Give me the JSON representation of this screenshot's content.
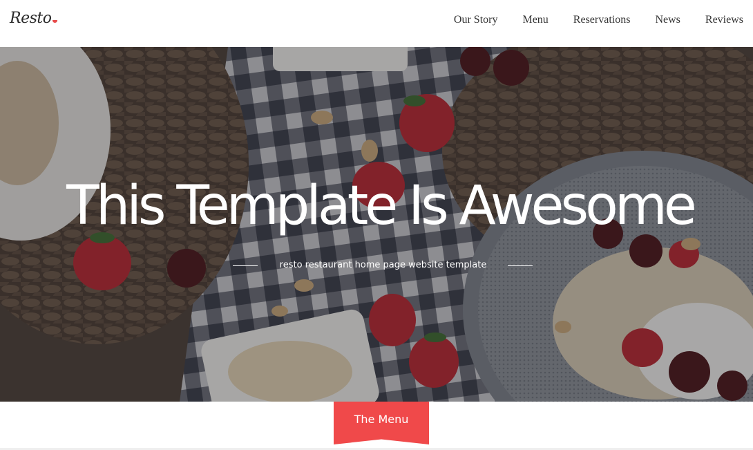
{
  "brand": {
    "logo_text": "Resto",
    "accent": "#f0494a"
  },
  "nav": {
    "items": [
      {
        "label": "Our Story"
      },
      {
        "label": "Menu"
      },
      {
        "label": "Reservations"
      },
      {
        "label": "News"
      },
      {
        "label": "Reviews"
      }
    ]
  },
  "hero": {
    "title": "This Template Is Awesome",
    "subtitle": "resto restaurant home page website template"
  },
  "section": {
    "menu_label": "The Menu"
  }
}
